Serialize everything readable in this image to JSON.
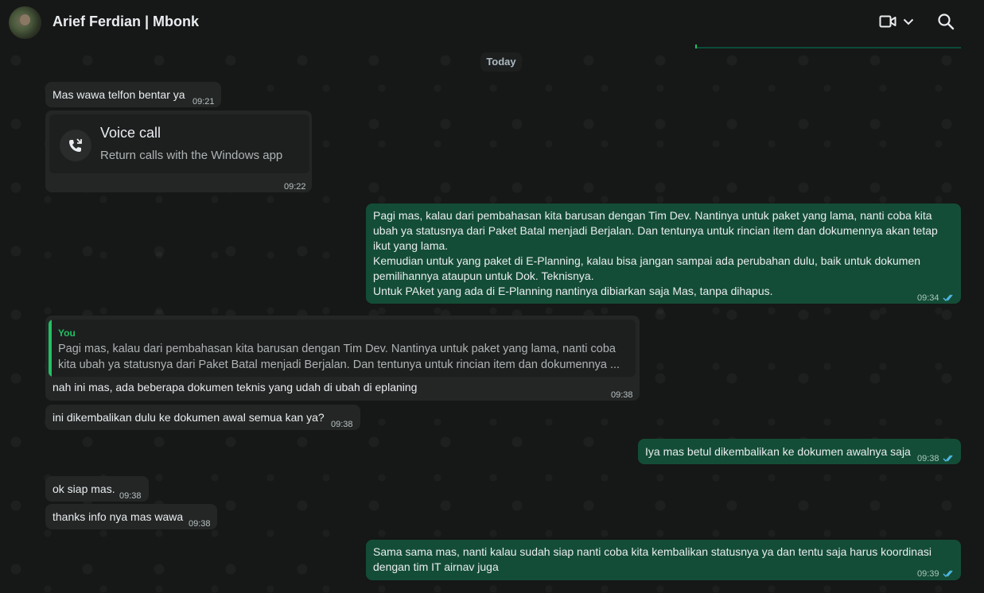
{
  "header": {
    "contact_name": "Arief Ferdian | Mbonk",
    "avatar_icon": "contact-avatar",
    "video_icon": "video-call-icon",
    "chevron_icon": "chevron-down-icon",
    "search_icon": "search-icon"
  },
  "colors": {
    "background": "#161717",
    "incoming_bubble": "#242626",
    "outgoing_bubble": "#144d37",
    "accent": "#21c063",
    "read_ticks": "#53bdeb"
  },
  "date_divider": "Today",
  "messages": [
    {
      "direction": "in",
      "text": "Mas wawa telfon bentar ya",
      "time": "09:21"
    },
    {
      "direction": "in",
      "type": "voice_call",
      "title": "Voice call",
      "subtitle": "Return calls with the Windows app",
      "time": "09:22"
    },
    {
      "direction": "out",
      "lines": [
        "Pagi mas, kalau dari pembahasan kita barusan dengan Tim Dev. Nantinya untuk paket yang lama, nanti coba kita",
        "ubah ya statusnya dari Paket Batal menjadi Berjalan. Dan tentunya untuk rincian item dan dokumennya akan tetap",
        "ikut yang lama.",
        "Kemudian untuk yang paket di E-Planning, kalau bisa jangan sampai ada perubahan dulu, baik untuk dokumen",
        "pemilihannya ataupun untuk Dok. Teknisnya.",
        "Untuk PAket yang ada di E-Planning nantinya dibiarkan saja Mas, tanpa dihapus."
      ],
      "time": "09:34",
      "status": "read"
    },
    {
      "direction": "in",
      "quoted": {
        "author": "You",
        "lines": [
          "Pagi mas, kalau dari pembahasan kita barusan dengan Tim Dev. Nantinya untuk paket yang lama, nanti coba",
          "kita ubah ya statusnya dari Paket Batal menjadi Berjalan. Dan tentunya untuk rincian item dan dokumennya ..."
        ]
      },
      "text": "nah ini mas, ada beberapa dokumen teknis yang udah di ubah di eplaning",
      "time": "09:38"
    },
    {
      "direction": "in",
      "text": "ini dikembalikan dulu ke dokumen awal semua kan ya?",
      "time": "09:38"
    },
    {
      "direction": "out",
      "text": "Iya mas betul dikembalikan ke dokumen awalnya saja",
      "time": "09:38",
      "status": "read"
    },
    {
      "direction": "in",
      "text": "ok siap mas.",
      "time": "09:38"
    },
    {
      "direction": "in",
      "text": "thanks info nya mas wawa",
      "time": "09:38"
    },
    {
      "direction": "out",
      "lines": [
        "Sama sama mas, nanti kalau sudah siap nanti coba kita kembalikan statusnya ya dan tentu saja harus koordinasi",
        "dengan tim IT airnav juga"
      ],
      "time": "09:39",
      "status": "read"
    }
  ]
}
